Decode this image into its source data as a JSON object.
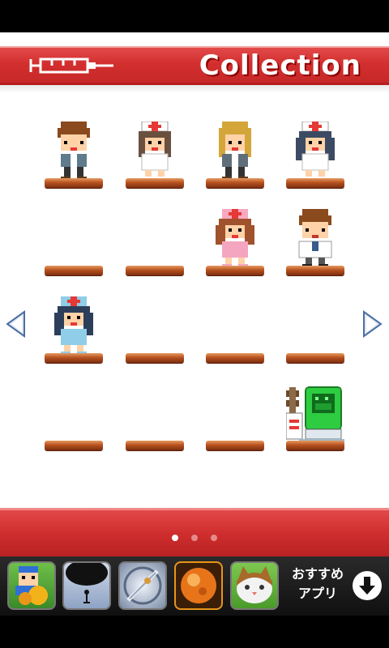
{
  "header": {
    "title": "Collection",
    "icon": "syringe-icon"
  },
  "grid": {
    "slots": [
      {
        "character": "brown-hair-boy"
      },
      {
        "character": "nurse-brown-hair"
      },
      {
        "character": "blonde-girl"
      },
      {
        "character": "nurse-dark-hair"
      },
      {
        "character": "empty"
      },
      {
        "character": "empty"
      },
      {
        "character": "pink-nurse"
      },
      {
        "character": "doctor-brown-hair"
      },
      {
        "character": "blue-nurse"
      },
      {
        "character": "empty"
      },
      {
        "character": "empty"
      },
      {
        "character": "empty"
      },
      {
        "character": "empty"
      },
      {
        "character": "empty"
      },
      {
        "character": "empty"
      },
      {
        "character": "green-monster-machine"
      }
    ]
  },
  "navigation": {
    "left": "arrow-left-icon",
    "right": "arrow-right-icon"
  },
  "pagination": {
    "pages": 3,
    "current": 1
  },
  "ad_bar": {
    "apps": [
      "blue-knight-app",
      "dark-bowl-app",
      "silver-blade-app",
      "orange-orb-app",
      "cat-face-app"
    ],
    "label_line1": "おすすめ",
    "label_line2": "アプリ",
    "download_icon": "download-icon"
  },
  "colors": {
    "header_red": "#d32f2f",
    "pedestal": "#b8521f",
    "ad_bar_bg": "#1a1a1a"
  }
}
